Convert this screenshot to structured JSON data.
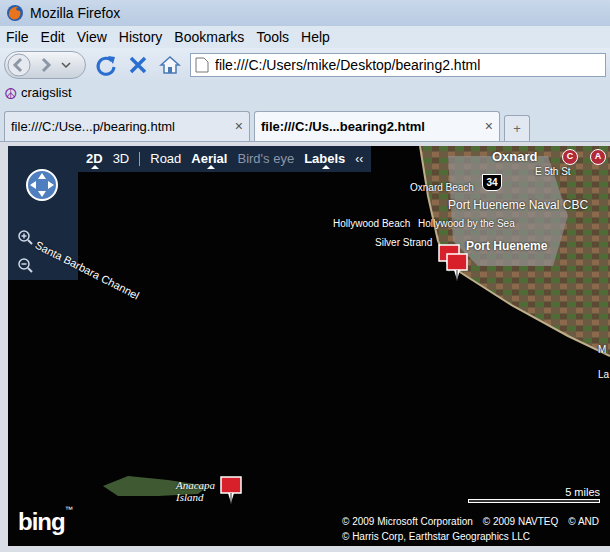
{
  "window": {
    "title": "Mozilla Firefox"
  },
  "menu": [
    "File",
    "Edit",
    "View",
    "History",
    "Bookmarks",
    "Tools",
    "Help"
  ],
  "address": {
    "url": "file:///C:/Users/mike/Desktop/bearing2.html"
  },
  "bookmarks": [
    {
      "icon": "☮",
      "label": "craigslist"
    }
  ],
  "tabs": [
    {
      "label": "file:///C:/Use...p/bearing.html",
      "close": "×",
      "selected": false
    },
    {
      "label": "file:///C:/Us...bearing2.html",
      "close": "×",
      "selected": true
    }
  ],
  "new_tab": "+",
  "map": {
    "view_modes": [
      {
        "label": "2D",
        "selected": true
      },
      {
        "label": "3D",
        "selected": false
      }
    ],
    "styles": [
      {
        "label": "Road",
        "selected": false,
        "disabled": false
      },
      {
        "label": "Aerial",
        "selected": true,
        "disabled": false
      },
      {
        "label": "Bird's eye",
        "selected": false,
        "disabled": true
      }
    ],
    "labels_toggle": {
      "label": "Labels",
      "on": true
    },
    "collapse": "‹‹",
    "place_labels": [
      "Oxnard",
      "E 5th St",
      "Oxnard Beach",
      "Port Hueneme Naval CBC",
      "Hollywood Beach",
      "Hollywood by the Sea",
      "Silver Strand",
      "Port Hueneme",
      "Santa Barbara Channel",
      "Anacapa Island",
      "M",
      "La"
    ],
    "road_shield": "34",
    "pois": [
      "C",
      "A"
    ],
    "scale": "5 miles",
    "copyright": [
      "© 2009 Microsoft Corporation",
      "© 2009 NAVTEQ",
      "© AND",
      "© Harris Corp, Earthstar Geographics LLC"
    ],
    "logo": "bing",
    "logo_mark": "™"
  }
}
